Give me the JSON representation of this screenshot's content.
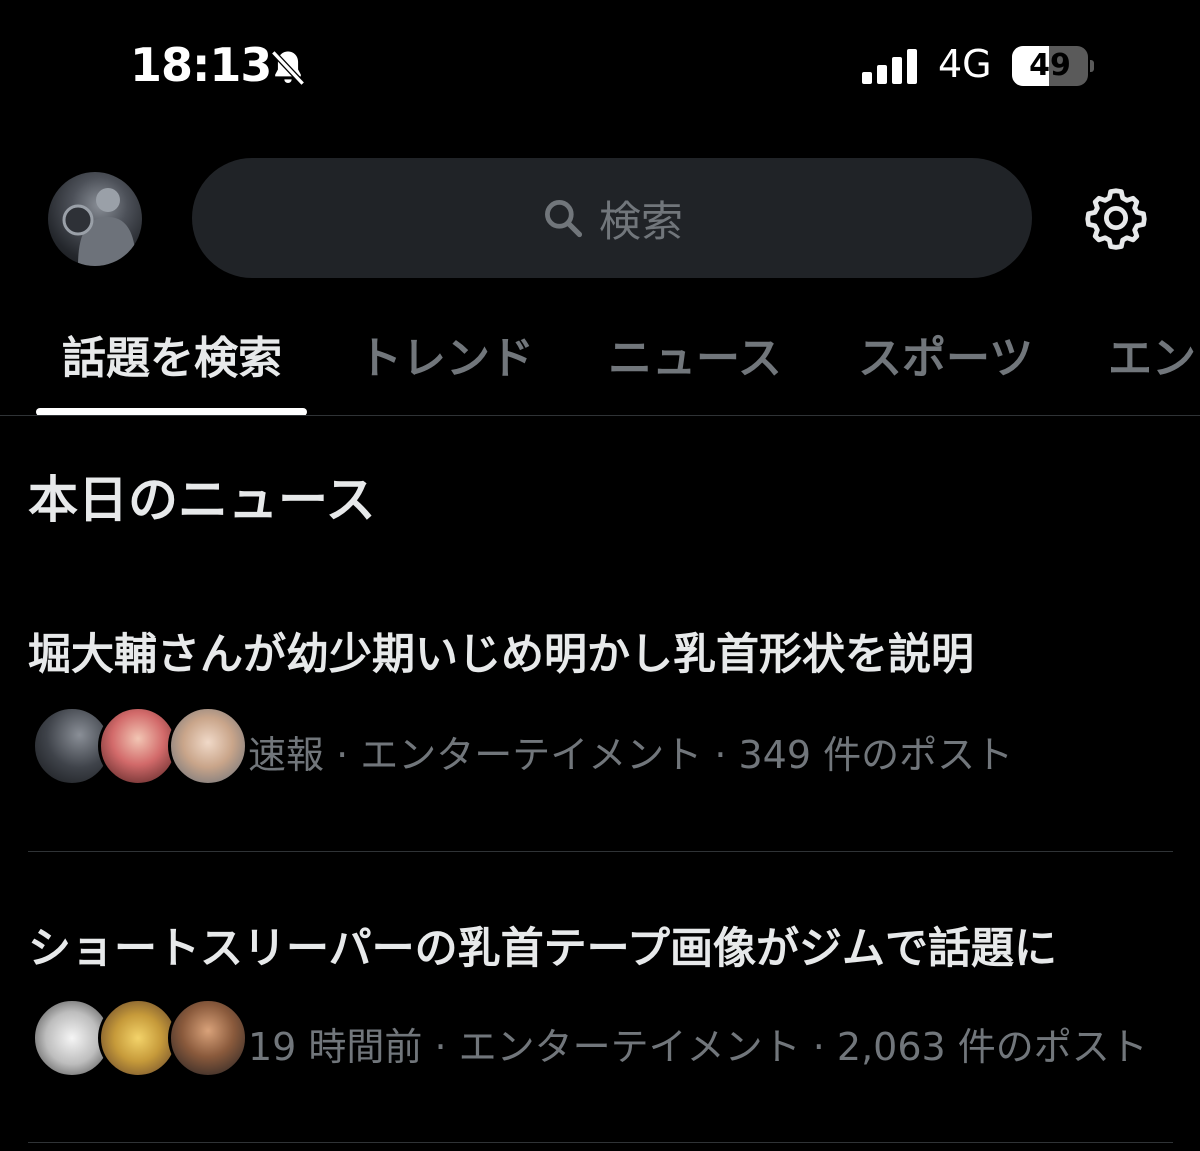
{
  "status_bar": {
    "time": "18:13",
    "network": "4G",
    "battery_percent": 49,
    "battery_label": "49"
  },
  "search": {
    "placeholder": "検索"
  },
  "tabs": [
    {
      "label": "話題を検索",
      "active": true
    },
    {
      "label": "トレンド",
      "active": false
    },
    {
      "label": "ニュース",
      "active": false
    },
    {
      "label": "スポーツ",
      "active": false
    },
    {
      "label": "エン",
      "active": false
    }
  ],
  "section": {
    "title": "本日のニュース"
  },
  "news": [
    {
      "headline": "堀大輔さんが幼少期いじめ明かし乳首形状を説明",
      "meta": "速報 · エンターテイメント · 349 件のポスト"
    },
    {
      "headline": "ショートスリーパーの乳首テープ画像がジムで話題に",
      "meta": "19 時間前 · エンターテイメント · 2,063 件のポスト"
    }
  ],
  "colors": {
    "background": "#000000",
    "primary_text": "#e7e9ea",
    "secondary_text": "#71767b",
    "search_bg": "#202327",
    "divider": "#2f3336"
  },
  "icons": {
    "bell": "bell-slash-icon",
    "signal": "cellular-signal-icon",
    "search": "search-icon",
    "settings": "gear-icon"
  }
}
